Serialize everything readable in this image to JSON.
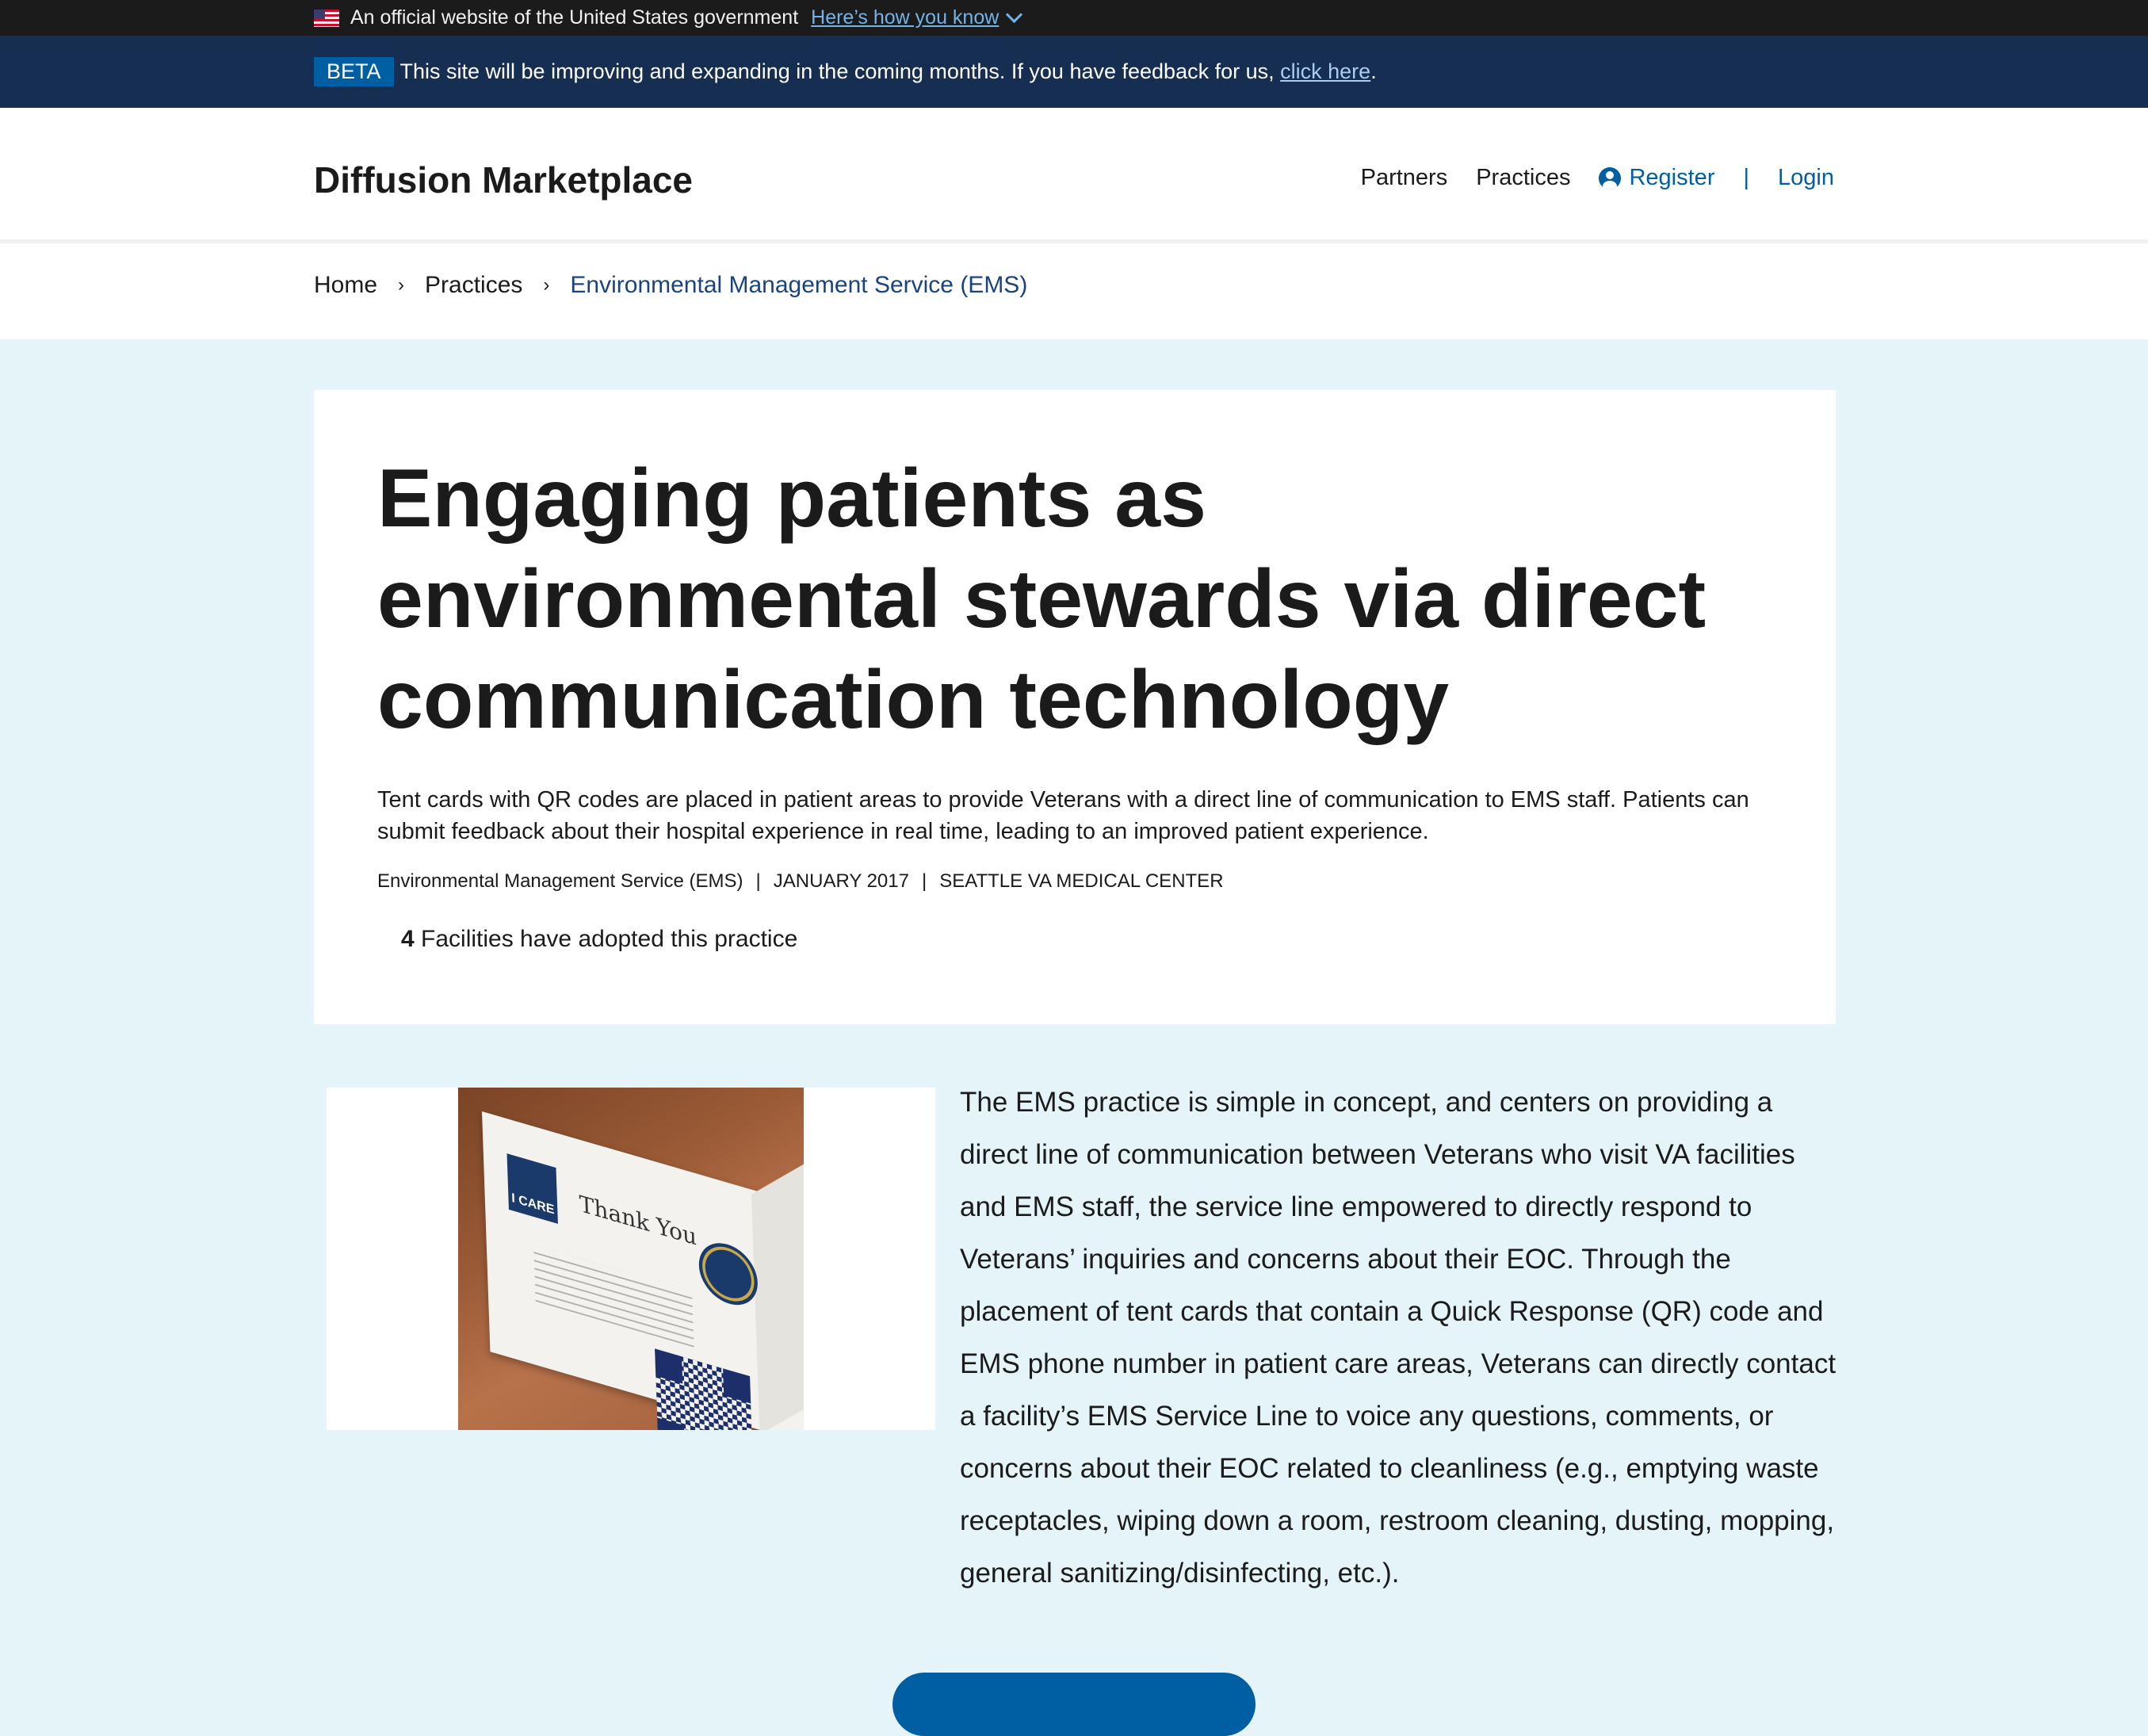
{
  "gov_banner": {
    "text": "An official website of the United States government",
    "link": "Here’s how you know"
  },
  "beta_banner": {
    "tag": "BETA",
    "text": "This site will be improving and expanding in the coming months. If you have feedback for us,",
    "link": "click here",
    "trailing": "."
  },
  "header": {
    "logo": "Diffusion Marketplace",
    "nav": {
      "partners": "Partners",
      "practices": "Practices",
      "register": "Register",
      "separator": "|",
      "login": "Login"
    }
  },
  "breadcrumb": {
    "items": [
      "Home",
      "Practices",
      "Environmental Management Service (EMS)"
    ],
    "separator": "›"
  },
  "hero": {
    "title": "Engaging patients as environmental stewards via direct communication technology",
    "summary": "Tent cards with QR codes are placed in patient areas to provide Veterans with a direct line of communication to EMS staff. Patients can submit feedback about their hospital experience in real time, leading to an improved patient experience.",
    "meta": [
      "Environmental Management Service (EMS)",
      "JANUARY 2017",
      "SEATTLE VA MEDICAL CENTER"
    ],
    "meta_separator": "|",
    "adopted_count": "4",
    "adopted_text": "Facilities have adopted this practice"
  },
  "image": {
    "card_logo": "I CARE",
    "card_title": "Thank You"
  },
  "body": {
    "paragraph": "The EMS practice is simple in concept, and centers on providing a direct line of communication between Veterans who visit VA facilities and EMS staff, the service line empowered to directly respond to Veterans’ inquiries and concerns about their EOC. Through the placement of tent cards that contain a Quick Response (QR) code and EMS phone number in patient care areas, Veterans can directly contact a facility’s EMS Service Line to voice any questions, comments, or concerns about their EOC related to cleanliness (e.g., emptying waste receptacles, wiping down a room, restroom cleaning, dusting, mopping, general sanitizing/disinfecting, etc.)."
  },
  "colors": {
    "gov_banner_bg": "#1b1b1b",
    "beta_banner_bg": "#162e51",
    "primary": "#005ea2",
    "page_bg": "#e5f4f8"
  }
}
